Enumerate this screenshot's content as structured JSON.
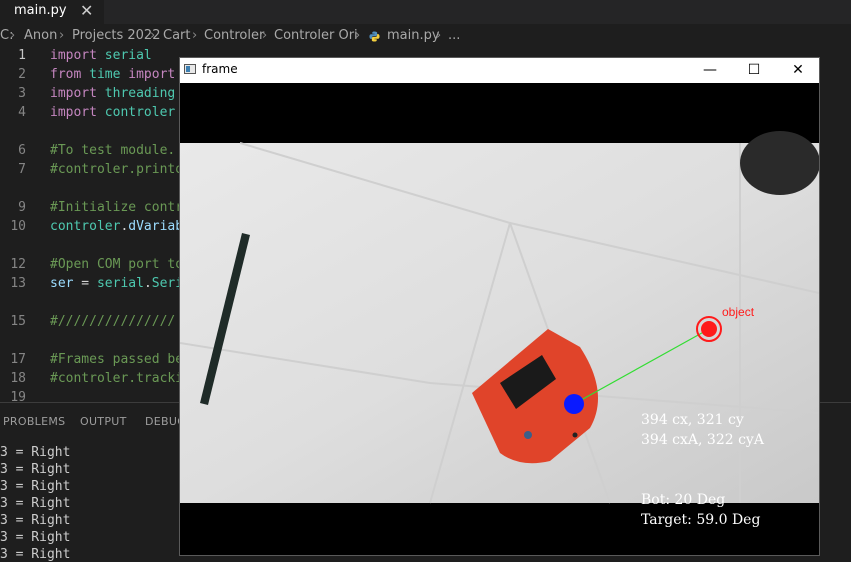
{
  "editor": {
    "tab": {
      "label": "main.py",
      "close": "✕"
    },
    "breadcrumb": [
      "C:",
      "Anon",
      "Projects 2022",
      "Cart",
      "Controler",
      "Controler Ori",
      "main.py",
      "..."
    ],
    "lines": [
      {
        "n": "1",
        "parts": [
          [
            "kw",
            "import "
          ],
          [
            "id",
            "serial"
          ]
        ]
      },
      {
        "n": "2",
        "parts": [
          [
            "kw",
            "from "
          ],
          [
            "id",
            "time "
          ],
          [
            "kw",
            "import"
          ]
        ]
      },
      {
        "n": "3",
        "parts": [
          [
            "kw",
            "import "
          ],
          [
            "id",
            "threading"
          ]
        ]
      },
      {
        "n": "4",
        "parts": [
          [
            "kw",
            "import "
          ],
          [
            "id",
            "controler"
          ]
        ]
      },
      {
        "n": "6",
        "parts": [
          [
            "cm",
            "#To test module."
          ]
        ]
      },
      {
        "n": "7",
        "parts": [
          [
            "cm",
            "#controler.printo"
          ]
        ]
      },
      {
        "n": "9",
        "parts": [
          [
            "cm",
            "#Initialize contr"
          ]
        ]
      },
      {
        "n": "10",
        "parts": [
          [
            "id",
            "controler"
          ],
          [
            "pl",
            "."
          ],
          [
            "var",
            "dVariab"
          ]
        ]
      },
      {
        "n": "12",
        "parts": [
          [
            "cm",
            "#Open COM port to"
          ]
        ]
      },
      {
        "n": "13",
        "parts": [
          [
            "var",
            "ser"
          ],
          [
            "pl",
            " = "
          ],
          [
            "id",
            "serial"
          ],
          [
            "pl",
            "."
          ],
          [
            "id",
            "Seri"
          ]
        ]
      },
      {
        "n": "15",
        "parts": [
          [
            "cm",
            "#///////////////"
          ]
        ]
      },
      {
        "n": "17",
        "parts": [
          [
            "cm",
            "#Frames passed be"
          ]
        ]
      },
      {
        "n": "18",
        "parts": [
          [
            "cm",
            "#controler.tracki"
          ]
        ]
      },
      {
        "n": "19",
        "parts": []
      }
    ]
  },
  "panel": {
    "tabs": [
      "PROBLEMS",
      "OUTPUT",
      "DEBUG"
    ],
    "output": [
      "3 = Right",
      "3 = Right",
      "3 = Right",
      "3 = Right",
      "3 = Right",
      "3 = Right",
      "3 = Right"
    ]
  },
  "cv_window": {
    "title": "frame",
    "minimize": "—",
    "maximize": "☐",
    "close": "✕",
    "object_label": "object",
    "cx_text": "394 cx, 321 cy",
    "cxa_text": "394 cxA, 322 cyA",
    "bot_text": "Bot: 20 Deg",
    "target_text": "Target: 59.0 Deg",
    "colors": {
      "object": "#ff1a1a",
      "bot_marker": "#0a1aff",
      "link_line": "#33dd33"
    }
  }
}
